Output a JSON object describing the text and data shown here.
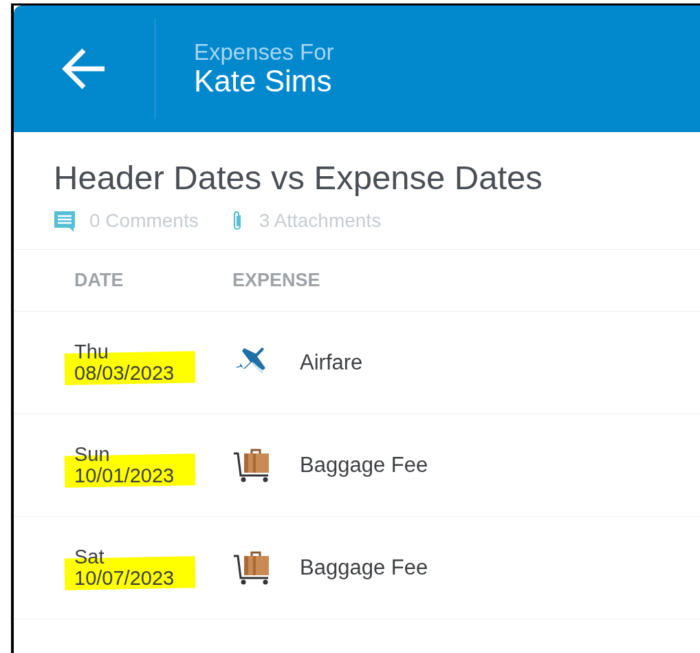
{
  "header": {
    "subtitle": "Expenses For",
    "title": "Kate Sims"
  },
  "report": {
    "title": "Header Dates vs Expense Dates",
    "comments": "0 Comments",
    "attachments": "3 Attachments"
  },
  "table": {
    "columns": [
      "DATE",
      "EXPENSE"
    ],
    "rows": [
      {
        "day": "Thu",
        "date": "08/03/2023",
        "highlighted": true,
        "kind": "airfare",
        "expense": "Airfare"
      },
      {
        "day": "Sun",
        "date": "10/01/2023",
        "highlighted": true,
        "kind": "baggage",
        "expense": "Baggage Fee"
      },
      {
        "day": "Sat",
        "date": "10/07/2023",
        "highlighted": true,
        "kind": "baggage",
        "expense": "Baggage Fee"
      }
    ]
  }
}
